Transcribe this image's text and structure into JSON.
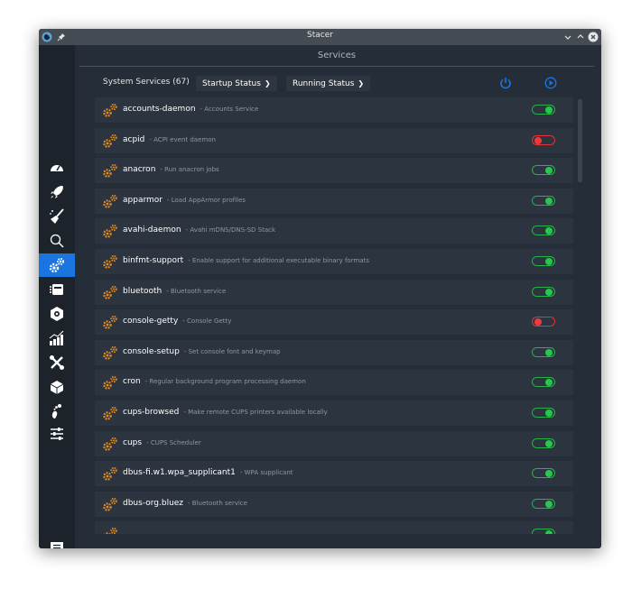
{
  "window": {
    "title": "Stacer",
    "header": "Services"
  },
  "toolbar": {
    "count_label": "System Services (67)",
    "startup_status_label": "Startup Status",
    "running_status_label": "Running Status"
  },
  "colors": {
    "accent": "#1a75e0",
    "on": "#25c84b",
    "off": "#ef3b3f",
    "gear": "#e38b24"
  },
  "sidebar": {
    "items": [
      {
        "icon": "dashboard-icon"
      },
      {
        "icon": "rocket-icon"
      },
      {
        "icon": "broom-icon"
      },
      {
        "icon": "search-icon"
      },
      {
        "icon": "gears-icon",
        "active": true
      },
      {
        "icon": "processes-icon"
      },
      {
        "icon": "uninstaller-icon"
      },
      {
        "icon": "resources-icon"
      },
      {
        "icon": "tools-icon"
      },
      {
        "icon": "apt-repository-icon"
      },
      {
        "icon": "gnome-icon"
      },
      {
        "icon": "settings-sliders-icon"
      },
      {
        "icon": "feedback-icon"
      }
    ]
  },
  "services": [
    {
      "name": "accounts-daemon",
      "desc": "- Accounts Service",
      "startup": true,
      "running": true
    },
    {
      "name": "acpid",
      "desc": "- ACPI event daemon",
      "startup": false,
      "running": true
    },
    {
      "name": "anacron",
      "desc": "- Run anacron jobs",
      "startup": true,
      "running": false
    },
    {
      "name": "apparmor",
      "desc": "- Load AppArmor profiles",
      "startup": true,
      "running": true
    },
    {
      "name": "avahi-daemon",
      "desc": "- Avahi mDNS/DNS-SD Stack",
      "startup": true,
      "running": true
    },
    {
      "name": "binfmt-support",
      "desc": "- Enable support for additional executable binary formats",
      "startup": true,
      "running": true
    },
    {
      "name": "bluetooth",
      "desc": "- Bluetooth service",
      "startup": true,
      "running": true
    },
    {
      "name": "console-getty",
      "desc": "- Console Getty",
      "startup": false,
      "running": false
    },
    {
      "name": "console-setup",
      "desc": "- Set console font and keymap",
      "startup": true,
      "running": true
    },
    {
      "name": "cron",
      "desc": "- Regular background program processing daemon",
      "startup": true,
      "running": true
    },
    {
      "name": "cups-browsed",
      "desc": "- Make remote CUPS printers available locally",
      "startup": true,
      "running": true
    },
    {
      "name": "cups",
      "desc": "- CUPS Scheduler",
      "startup": true,
      "running": true
    },
    {
      "name": "dbus-fi.w1.wpa_supplicant1",
      "desc": "- WPA supplicant",
      "startup": true,
      "running": true
    },
    {
      "name": "dbus-org.bluez",
      "desc": "- Bluetooth service",
      "startup": true,
      "running": true
    },
    {
      "name": "",
      "desc": "",
      "startup": true,
      "running": true
    }
  ]
}
